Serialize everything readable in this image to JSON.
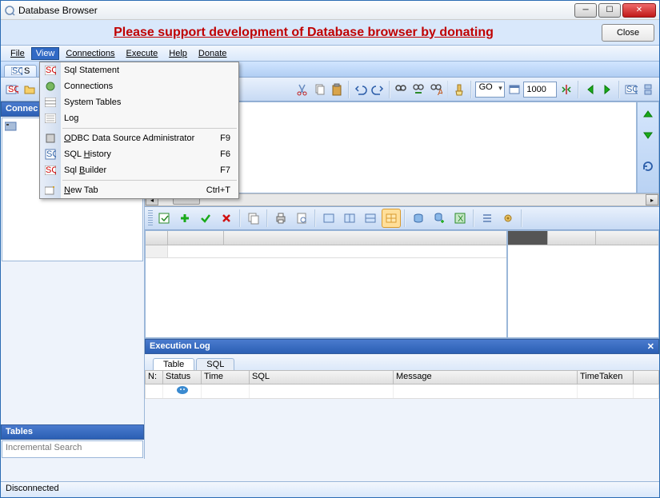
{
  "window": {
    "title": "Database Browser"
  },
  "banner": {
    "message": "Please support development of Database browser by donating",
    "close_label": "Close"
  },
  "menu": {
    "file": "File",
    "view": "View",
    "connections": "Connections",
    "execute": "Execute",
    "help": "Help",
    "donate": "Donate"
  },
  "view_menu": {
    "sql_statement": "Sql Statement",
    "connections": "Connections",
    "system_tables": "System Tables",
    "log": "Log",
    "odbc_admin": "ODBC Data Source Administrator",
    "odbc_admin_sc": "F9",
    "sql_history": "SQL History",
    "sql_history_sc": "F6",
    "sql_builder": "Sql Builder",
    "sql_builder_sc": "F7",
    "new_tab": "New Tab",
    "new_tab_sc": "Ctrl+T"
  },
  "tabs": {
    "sql": "S"
  },
  "toolbar": {
    "go_label": "GO",
    "rows_value": "1000"
  },
  "panels": {
    "connections_title": "Connec",
    "tables_title": "Tables",
    "incremental_search": "Incremental Search",
    "execution_log_title": "Execution Log"
  },
  "exec_tabs": {
    "table": "Table",
    "sql": "SQL"
  },
  "exec_cols": {
    "n": "N:",
    "status": "Status",
    "time": "Time",
    "sql": "SQL",
    "message": "Message",
    "timetaken": "TimeTaken"
  },
  "status": {
    "text": "Disconnected"
  }
}
